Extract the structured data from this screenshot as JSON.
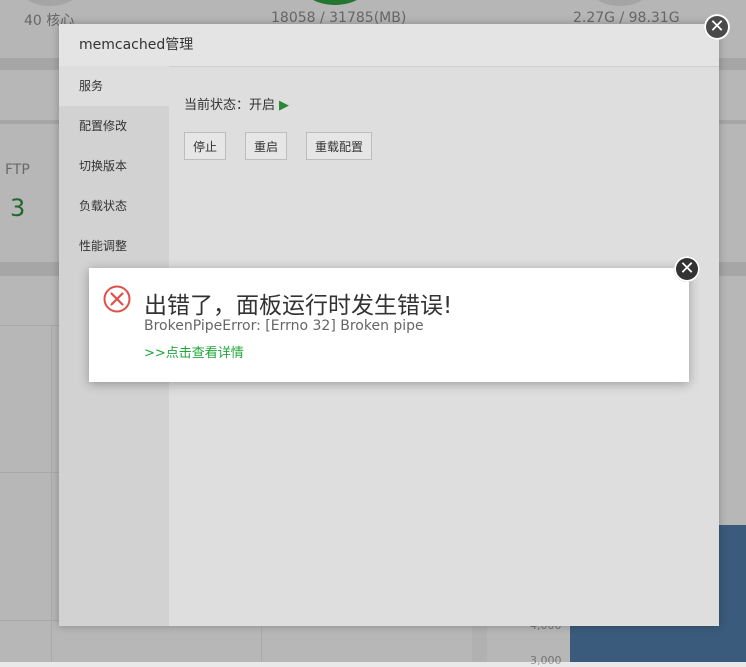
{
  "background": {
    "cpu_cores": "40 核心",
    "memory": "18058 / 31785(MB)",
    "disk": "2.27G / 98.31G",
    "ftp_label": "FTP",
    "ftp_count": "3",
    "chart_ticks": [
      "4,000",
      "3,000"
    ]
  },
  "dialog": {
    "title": "memcached管理",
    "menu": [
      "服务",
      "配置修改",
      "切换版本",
      "负载状态",
      "性能调整"
    ],
    "status_label": "当前状态：开启",
    "buttons": {
      "stop": "停止",
      "restart": "重启",
      "reload": "重载配置"
    }
  },
  "error": {
    "title": "出错了，面板运行时发生错误!",
    "message": "BrokenPipeError: [Errno 32] Broken pipe",
    "link": ">>点击查看详情"
  },
  "colors": {
    "success_green": "#20a53a",
    "error_red": "#e0504a"
  }
}
